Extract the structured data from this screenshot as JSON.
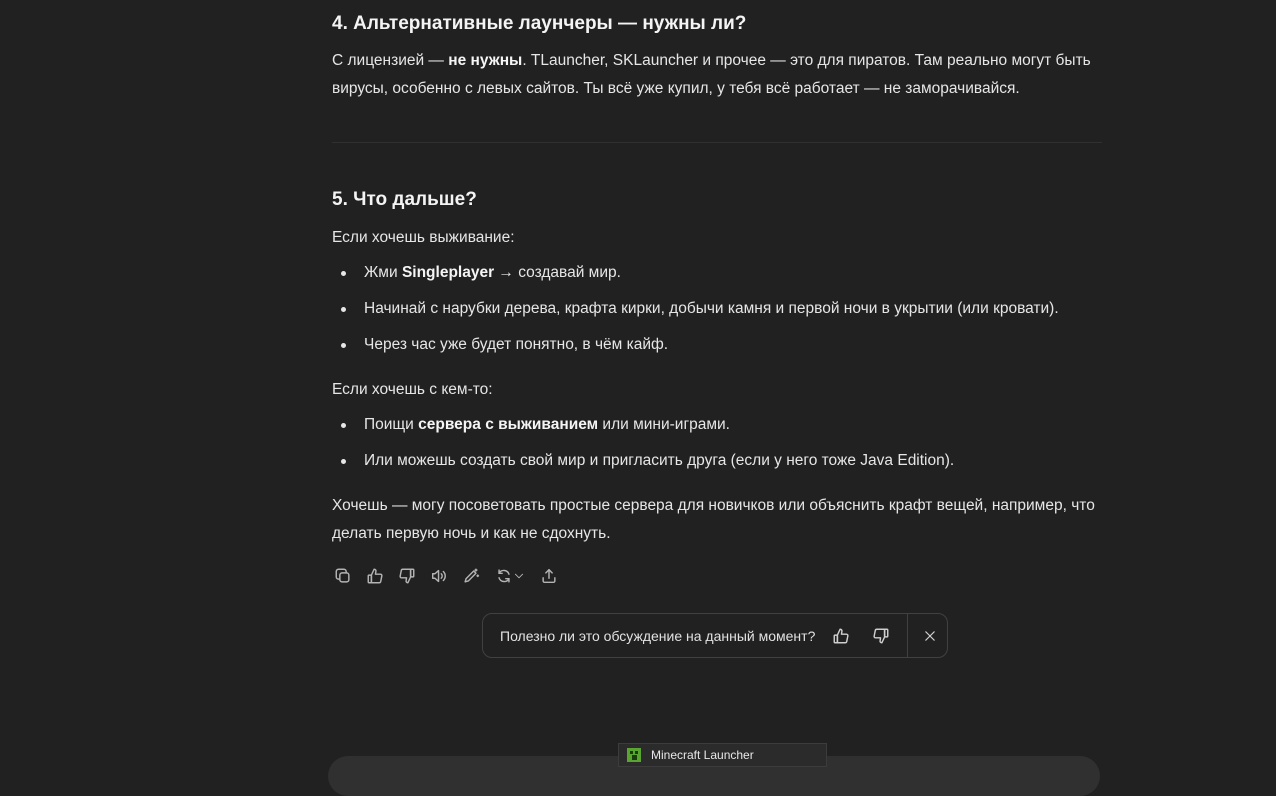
{
  "section4": {
    "title": "4. Альтернативные лаунчеры — нужны ли?",
    "p_before": "С лицензией — ",
    "p_bold": "не нужны",
    "p_after": ". TLauncher, SKLauncher и прочее — это для пиратов. Там реально могут быть вирусы, особенно с левых сайтов. Ты всё уже купил, у тебя всё работает — не заморачивайся."
  },
  "section5": {
    "title": "5. Что дальше?",
    "survival_intro": "Если хочешь выживание:",
    "survival_items": [
      {
        "before": "Жми ",
        "bold": "Singleplayer",
        "after": " → создавай мир."
      },
      {
        "text": "Начинай с нарубки дерева, крафта кирки, добычи камня и первой ночи в укрытии (или кровати)."
      },
      {
        "text": "Через час уже будет понятно, в чём кайф."
      }
    ],
    "multi_intro": "Если хочешь с кем-то:",
    "multi_items": [
      {
        "before": "Поищи ",
        "bold": "сервера с выживанием",
        "after": " или мини-играми."
      },
      {
        "text": "Или можешь создать свой мир и пригласить друга (если у него тоже Java Edition)."
      }
    ],
    "closing": "Хочешь — могу посоветовать простые сервера для новичков или объяснить крафт вещей, например, что делать первую ночь и как не сдохнуть."
  },
  "actions": {
    "icons": [
      "copy-icon",
      "thumbs-up-icon",
      "thumbs-down-icon",
      "read-aloud-icon",
      "edit-icon",
      "regenerate-icon",
      "share-icon"
    ]
  },
  "feedback": {
    "question": "Полезно ли это обсуждение на данный момент?"
  },
  "taskbar": {
    "app_title": "Minecraft Launcher"
  },
  "colors": {
    "background": "#212121",
    "text": "#ececec",
    "icon": "#b4b4b4",
    "border": "#414141"
  }
}
